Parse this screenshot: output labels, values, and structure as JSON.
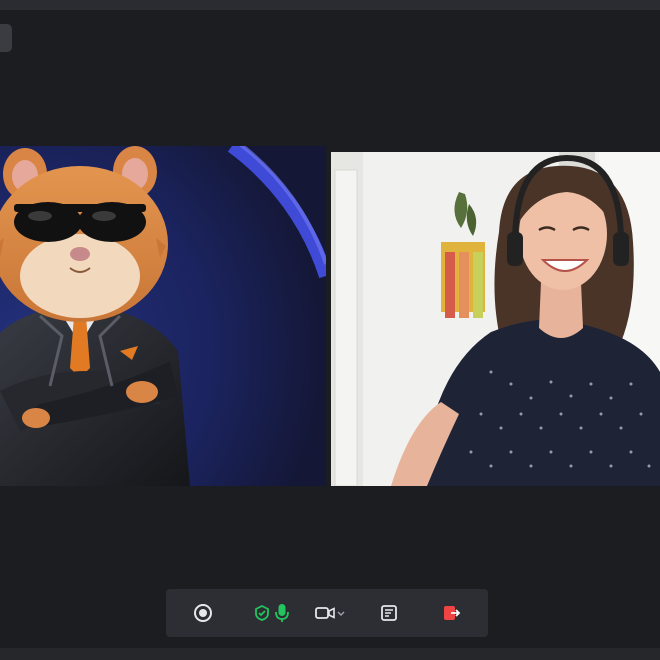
{
  "call": {
    "participants": [
      {
        "tile": "left",
        "avatar": "hamster-agent-avatar"
      },
      {
        "tile": "right",
        "avatar": "smiling-woman-headset-video"
      }
    ]
  },
  "controls": {
    "record": {
      "icon": "record-icon"
    },
    "microphone": {
      "icons": [
        "shield-icon",
        "microphone-icon"
      ],
      "state": "active",
      "accent": "#22c55e"
    },
    "camera": {
      "icons": [
        "camera-icon",
        "chevron-down-icon"
      ]
    },
    "share_screen": {
      "icon": "share-screen-icon"
    },
    "leave": {
      "icon": "leave-call-icon",
      "accent": "#ef4444"
    }
  },
  "theme": {
    "background": "#1c1d20",
    "control_bar": "#2c2e33",
    "tile_left_accent": "#3f4bd6"
  }
}
